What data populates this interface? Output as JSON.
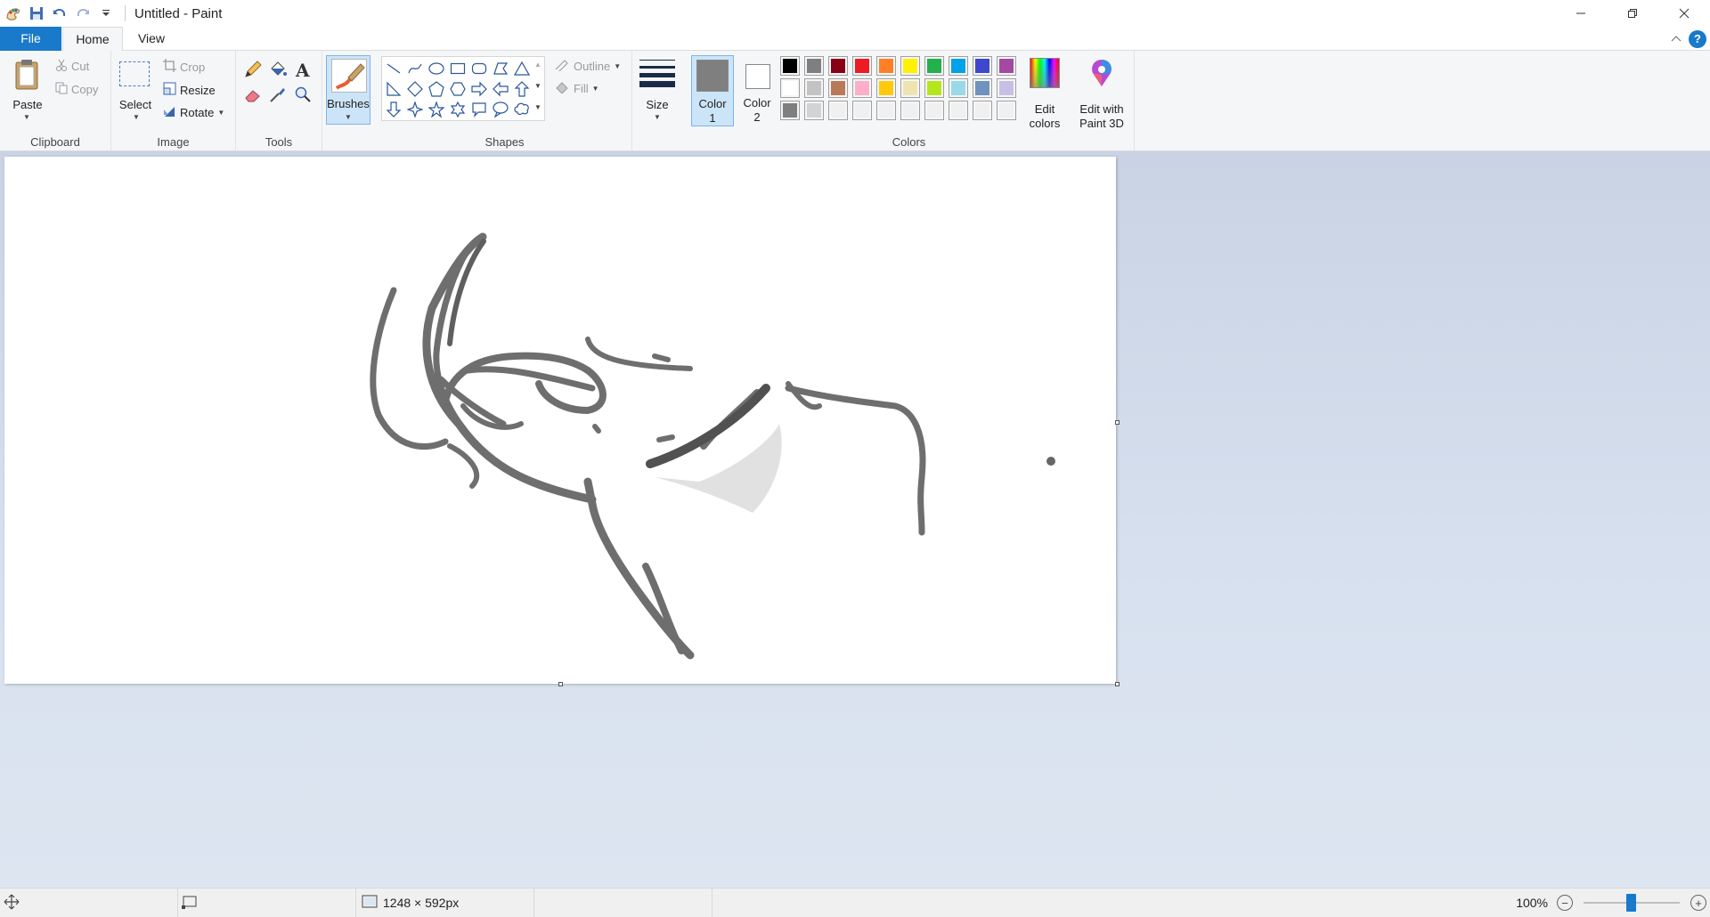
{
  "window": {
    "title": "Untitled - Paint"
  },
  "tabs": {
    "file": "File",
    "home": "Home",
    "view": "View"
  },
  "clipboard": {
    "label": "Clipboard",
    "paste": "Paste",
    "cut": "Cut",
    "copy": "Copy"
  },
  "image_group": {
    "label": "Image",
    "select": "Select",
    "crop": "Crop",
    "resize": "Resize",
    "rotate": "Rotate"
  },
  "tools": {
    "label": "Tools"
  },
  "brushes": {
    "label": "Brushes"
  },
  "shapes": {
    "label": "Shapes",
    "outline": "Outline",
    "fill": "Fill"
  },
  "size": {
    "label": "Size"
  },
  "colors": {
    "label": "Colors",
    "color1_label_a": "Color",
    "color1_label_b": "1",
    "color2_label_a": "Color",
    "color2_label_b": "2",
    "edit_colors_a": "Edit",
    "edit_colors_b": "colors",
    "color1": "#7f7f7f",
    "color2": "#ffffff",
    "palette_row1": [
      "#000000",
      "#7f7f7f",
      "#880015",
      "#ed1c24",
      "#ff7f27",
      "#fff200",
      "#22b14c",
      "#00a2e8",
      "#3f48cc",
      "#a349a4"
    ],
    "palette_row2": [
      "#ffffff",
      "#c3c3c3",
      "#b97a57",
      "#ffaec9",
      "#ffc90e",
      "#efe4b0",
      "#b5e61d",
      "#99d9ea",
      "#7092be",
      "#c8bfe7"
    ],
    "palette_row3": [
      "#7f7f7f",
      "#d3d3d3",
      "#f0f0f0",
      "#f0f0f0",
      "#f0f0f0",
      "#f0f0f0",
      "#f0f0f0",
      "#f0f0f0",
      "#f0f0f0",
      "#f0f0f0"
    ]
  },
  "paint3d": {
    "label_a": "Edit with",
    "label_b": "Paint 3D"
  },
  "status": {
    "dimensions": "1248 × 592px",
    "zoom": "100%"
  }
}
